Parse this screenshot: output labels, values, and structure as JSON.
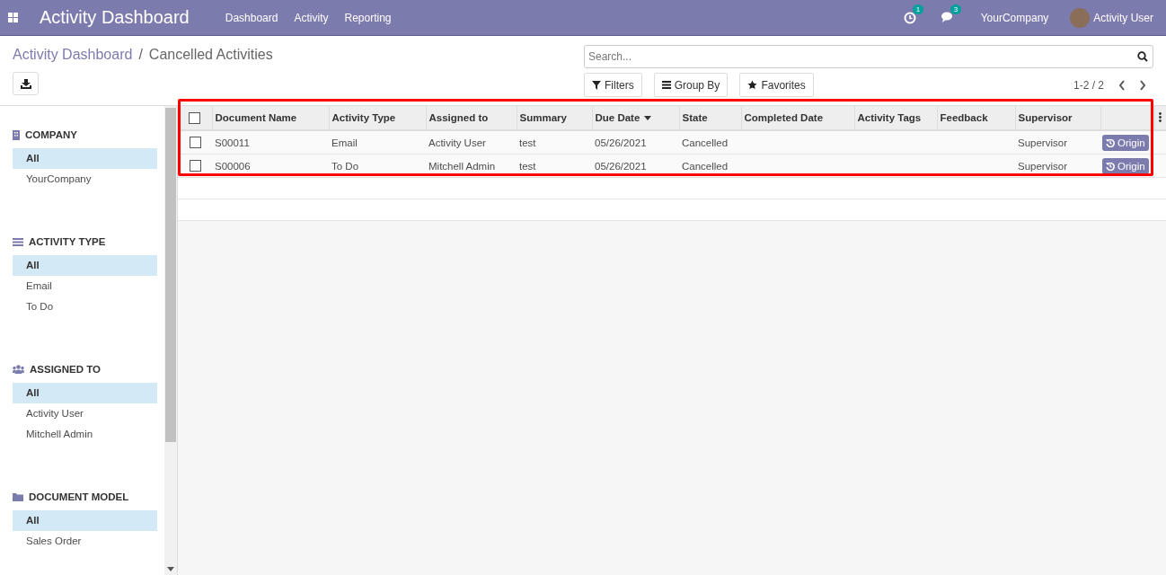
{
  "navbar": {
    "app_title": "Activity Dashboard",
    "menu": [
      {
        "label": "Dashboard"
      },
      {
        "label": "Activity"
      },
      {
        "label": "Reporting"
      }
    ],
    "activity_count": "1",
    "message_count": "3",
    "company": "YourCompany",
    "user": "Activity User"
  },
  "breadcrumb_separator": "/",
  "breadcrumb": [
    {
      "label": "Activity Dashboard",
      "kind": "link"
    },
    {
      "label": "Cancelled Activities",
      "kind": "current"
    }
  ],
  "search": {
    "placeholder": "Search..."
  },
  "filter_buttons": [
    {
      "label": "Filters",
      "kind": "filter"
    },
    {
      "label": "Group By",
      "kind": "group"
    },
    {
      "label": "Favorites",
      "kind": "star"
    }
  ],
  "pager": "1-2 / 2",
  "sidebar": [
    {
      "title": "COMPANY",
      "kind": "building",
      "items": [
        {
          "label": "All",
          "selected": true
        },
        {
          "label": "YourCompany",
          "selected": false
        }
      ]
    },
    {
      "title": "ACTIVITY TYPE",
      "kind": "list",
      "items": [
        {
          "label": "All",
          "selected": true
        },
        {
          "label": "Email",
          "selected": false
        },
        {
          "label": "To Do",
          "selected": false
        }
      ]
    },
    {
      "title": "ASSIGNED TO",
      "kind": "users",
      "items": [
        {
          "label": "All",
          "selected": true
        },
        {
          "label": "Activity User",
          "selected": false
        },
        {
          "label": "Mitchell Admin",
          "selected": false
        }
      ]
    },
    {
      "title": "DOCUMENT MODEL",
      "kind": "folder",
      "items": [
        {
          "label": "All",
          "selected": true
        },
        {
          "label": "Sales Order",
          "selected": false
        }
      ]
    }
  ],
  "table": {
    "select_all_checked": false,
    "columns": [
      {
        "label": "Document Name",
        "sorted": false
      },
      {
        "label": "Activity Type",
        "sorted": false
      },
      {
        "label": "Assigned to",
        "sorted": false
      },
      {
        "label": "Summary",
        "sorted": false
      },
      {
        "label": "Due Date",
        "sorted": true
      },
      {
        "label": "State",
        "sorted": false
      },
      {
        "label": "Completed Date",
        "sorted": false
      },
      {
        "label": "Activity Tags",
        "sorted": false
      },
      {
        "label": "Feedback",
        "sorted": false
      },
      {
        "label": "Supervisor",
        "sorted": false
      }
    ],
    "rows": [
      {
        "checked": false,
        "cells": [
          "S00011",
          "Email",
          "Activity User",
          "test",
          "05/26/2021",
          "Cancelled",
          "",
          "",
          "",
          "Supervisor"
        ],
        "button": "Origin"
      },
      {
        "checked": false,
        "cells": [
          "S00006",
          "To Do",
          "Mitchell Admin",
          "test",
          "05/26/2021",
          "Cancelled",
          "",
          "",
          "",
          "Supervisor"
        ],
        "button": "Origin"
      }
    ]
  }
}
